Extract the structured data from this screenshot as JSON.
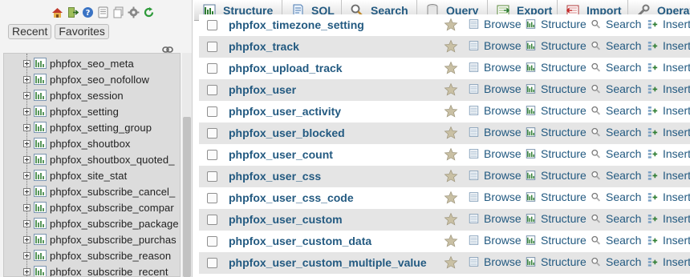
{
  "nav": {
    "recent_label": "Recent",
    "favorites_label": "Favorites",
    "tree_tables": [
      "phpfox_seo_meta",
      "phpfox_seo_nofollow",
      "phpfox_session",
      "phpfox_setting",
      "phpfox_setting_group",
      "phpfox_shoutbox",
      "phpfox_shoutbox_quoted_",
      "phpfox_site_stat",
      "phpfox_subscribe_cancel_",
      "phpfox_subscribe_compar",
      "phpfox_subscribe_package",
      "phpfox_subscribe_purchas",
      "phpfox_subscribe_reason",
      "phpfox_subscribe_recent_"
    ]
  },
  "tabs": [
    {
      "label": "Structure",
      "icon": "structure-icon"
    },
    {
      "label": "SQL",
      "icon": "sql-icon"
    },
    {
      "label": "Search",
      "icon": "search-icon"
    },
    {
      "label": "Query",
      "icon": "query-icon"
    },
    {
      "label": "Export",
      "icon": "export-icon"
    },
    {
      "label": "Import",
      "icon": "import-icon"
    },
    {
      "label": "Operat",
      "icon": "wrench-icon"
    }
  ],
  "actions": {
    "browse": "Browse",
    "structure": "Structure",
    "search": "Search",
    "insert": "Insert"
  },
  "tables": [
    "phpfox_timezone_setting",
    "phpfox_track",
    "phpfox_upload_track",
    "phpfox_user",
    "phpfox_user_activity",
    "phpfox_user_blocked",
    "phpfox_user_count",
    "phpfox_user_css",
    "phpfox_user_css_code",
    "phpfox_user_custom",
    "phpfox_user_custom_data",
    "phpfox_user_custom_multiple_value"
  ],
  "colors": {
    "link": "#235a81",
    "row_alt": "#e5e5e5",
    "nav_bg": "#f3f3f3"
  }
}
